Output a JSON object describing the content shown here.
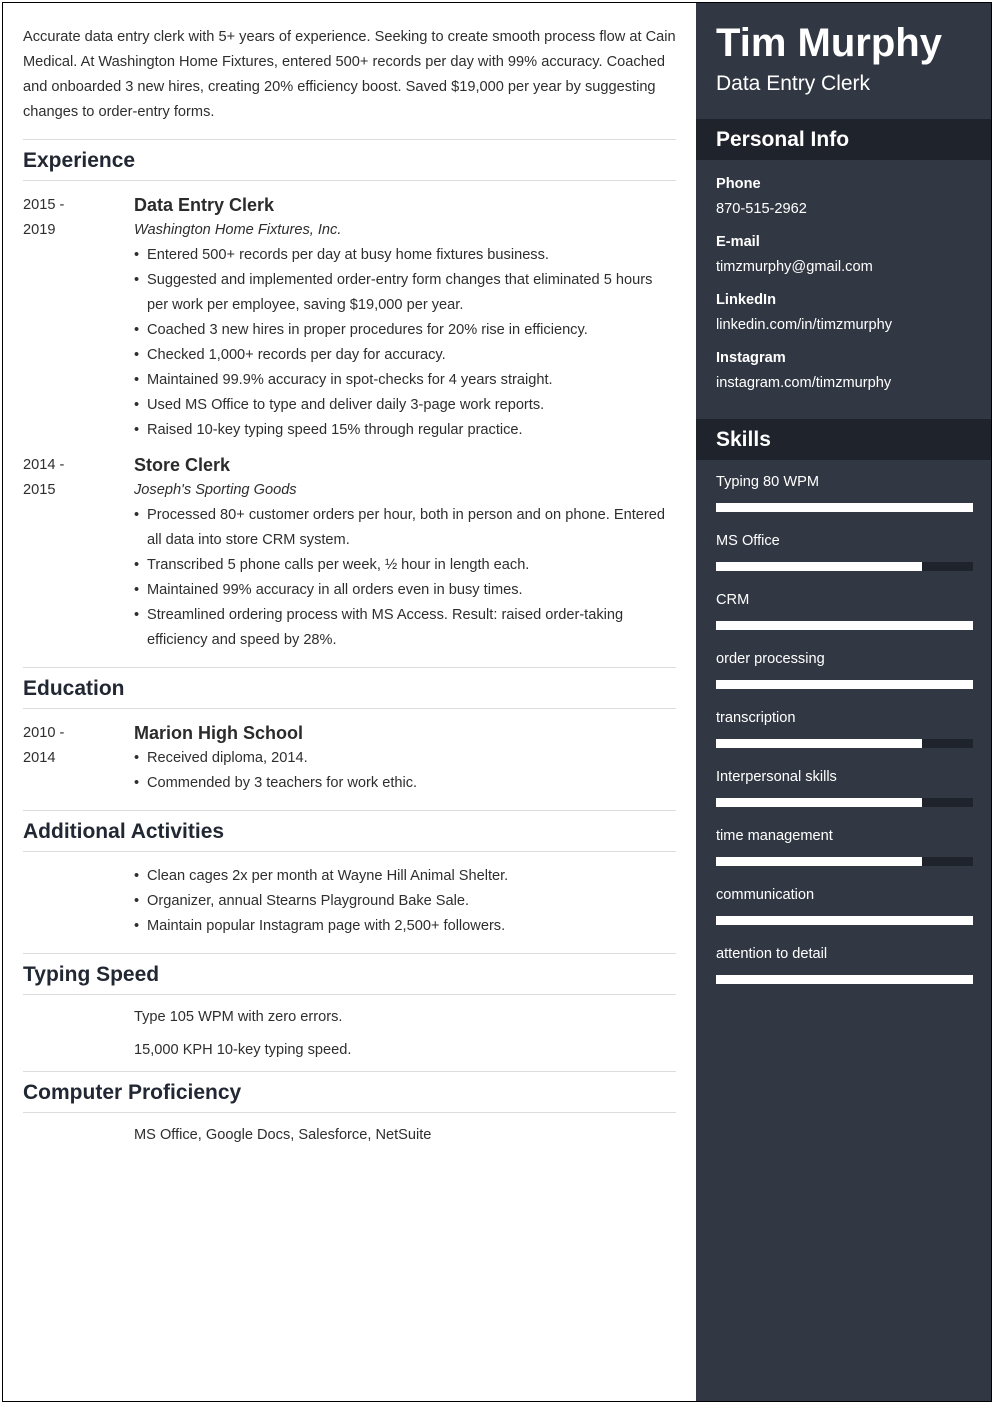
{
  "header": {
    "name": "Tim Murphy",
    "title": "Data Entry Clerk"
  },
  "summary": "Accurate data entry clerk with 5+ years of experience. Seeking to create smooth process flow at Cain Medical. At Washington Home Fixtures, entered 500+ records per day with 99% accuracy. Coached and onboarded 3 new hires, creating 20% efficiency boost. Saved $19,000 per year by suggesting changes to order-entry forms.",
  "experience": {
    "heading": "Experience",
    "jobs": [
      {
        "date_start": "2015 -",
        "date_end": "2019",
        "title": "Data Entry Clerk",
        "company": "Washington Home Fixtures, Inc.",
        "bullets": [
          "Entered 500+ records per day at busy home fixtures business.",
          "Suggested and implemented order-entry form changes that eliminated 5 hours per work per employee, saving $19,000 per year.",
          "Coached 3 new hires in proper procedures for 20% rise in efficiency.",
          "Checked 1,000+ records per day for accuracy.",
          "Maintained 99.9% accuracy in spot-checks for 4 years straight.",
          "Used MS Office to type and deliver daily 3-page work reports.",
          "Raised 10-key typing speed 15% through regular practice."
        ]
      },
      {
        "date_start": "2014 -",
        "date_end": "2015",
        "title": "Store Clerk",
        "company": "Joseph's Sporting Goods",
        "bullets": [
          "Processed 80+ customer orders per hour, both in person and on phone. Entered all data into store CRM system.",
          "Transcribed 5 phone calls per week, ½ hour in length each.",
          "Maintained 99% accuracy in all orders even in busy times.",
          "Streamlined ordering process with MS Access. Result: raised order-taking efficiency and speed by 28%."
        ]
      }
    ]
  },
  "education": {
    "heading": "Education",
    "entries": [
      {
        "date_start": "2010 -",
        "date_end": "2014",
        "school": "Marion High School",
        "bullets": [
          "Received diploma, 2014.",
          "Commended by 3 teachers for work ethic."
        ]
      }
    ]
  },
  "activities": {
    "heading": "Additional Activities",
    "bullets": [
      "Clean cages 2x per month at Wayne Hill Animal Shelter.",
      "Organizer, annual Stearns Playground Bake Sale.",
      "Maintain popular Instagram page with 2,500+ followers."
    ]
  },
  "typing_speed": {
    "heading": "Typing Speed",
    "lines": [
      "Type 105 WPM with zero errors.",
      "15,000 KPH 10-key typing speed."
    ]
  },
  "computer_proficiency": {
    "heading": "Computer Proficiency",
    "text": "MS Office, Google Docs, Salesforce, NetSuite"
  },
  "personal_info": {
    "heading": "Personal Info",
    "items": [
      {
        "label": "Phone",
        "value": "870-515-2962"
      },
      {
        "label": "E-mail",
        "value": "timzmurphy@gmail.com"
      },
      {
        "label": "LinkedIn",
        "value": "linkedin.com/in/timzmurphy"
      },
      {
        "label": "Instagram",
        "value": "instagram.com/timzmurphy"
      }
    ]
  },
  "skills": {
    "heading": "Skills",
    "items": [
      {
        "name": "Typing 80 WPM",
        "level": 1.0
      },
      {
        "name": "MS Office",
        "level": 0.8
      },
      {
        "name": "CRM",
        "level": 1.0
      },
      {
        "name": "order processing",
        "level": 1.0
      },
      {
        "name": "transcription",
        "level": 0.8
      },
      {
        "name": "Interpersonal skills",
        "level": 0.8
      },
      {
        "name": "time management",
        "level": 0.8
      },
      {
        "name": "communication",
        "level": 1.0
      },
      {
        "name": "attention to detail",
        "level": 1.0
      }
    ]
  },
  "colors": {
    "sidebar_bg": "#323843",
    "sidebar_header_bg": "#1f232b",
    "bar_fill": "#ffffff",
    "bar_track": "#1f232b"
  }
}
